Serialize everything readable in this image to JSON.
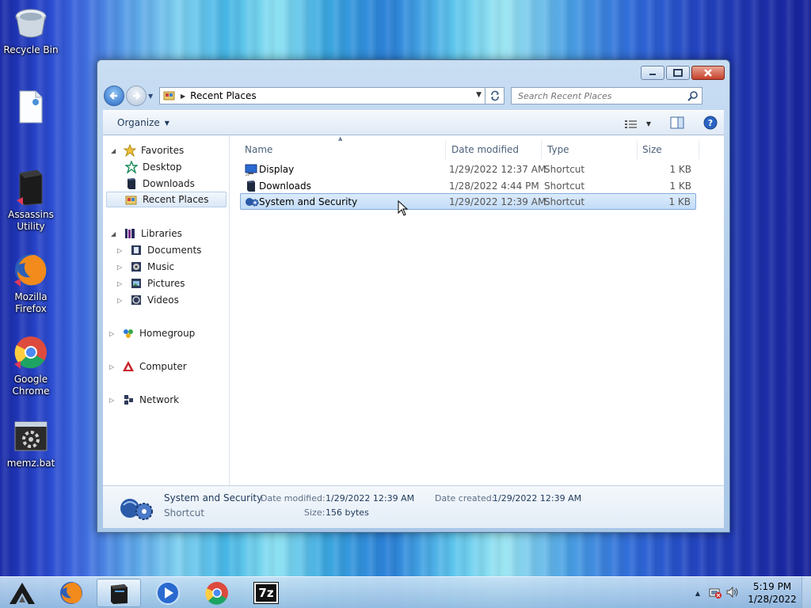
{
  "desktop": {
    "icons": [
      {
        "label": "Recycle Bin"
      },
      {
        "label": ""
      },
      {
        "label": "Assassins Utility"
      },
      {
        "label": "Mozilla Firefox"
      },
      {
        "label": "Google Chrome"
      },
      {
        "label": "memz.bat"
      }
    ]
  },
  "window": {
    "address": {
      "location": "Recent Places"
    },
    "search": {
      "placeholder": "Search Recent Places"
    },
    "toolbar": {
      "organize_label": "Organize"
    },
    "nav": {
      "favorites": {
        "label": "Favorites",
        "items": [
          "Desktop",
          "Downloads",
          "Recent Places"
        ]
      },
      "libraries": {
        "label": "Libraries",
        "items": [
          "Documents",
          "Music",
          "Pictures",
          "Videos"
        ]
      },
      "homegroup": "Homegroup",
      "computer": "Computer",
      "network": "Network"
    },
    "columns": {
      "name": "Name",
      "date": "Date modified",
      "type": "Type",
      "size": "Size"
    },
    "files": [
      {
        "name": "Display",
        "date": "1/29/2022 12:37 AM",
        "type": "Shortcut",
        "size": "1 KB"
      },
      {
        "name": "Downloads",
        "date": "1/28/2022 4:44 PM",
        "type": "Shortcut",
        "size": "1 KB"
      },
      {
        "name": "System and Security",
        "date": "1/29/2022 12:39 AM",
        "type": "Shortcut",
        "size": "1 KB"
      }
    ],
    "details": {
      "name": "System and Security",
      "kind": "Shortcut",
      "date_modified_label": "Date modified:",
      "date_modified": "1/29/2022 12:39 AM",
      "date_created_label": "Date created:",
      "date_created": "1/29/2022 12:39 AM",
      "size_label": "Size:",
      "size": "156 bytes"
    }
  },
  "taskbar": {
    "clock_time": "5:19 PM",
    "clock_date": "1/28/2022",
    "sevenzip_label": "7z"
  }
}
